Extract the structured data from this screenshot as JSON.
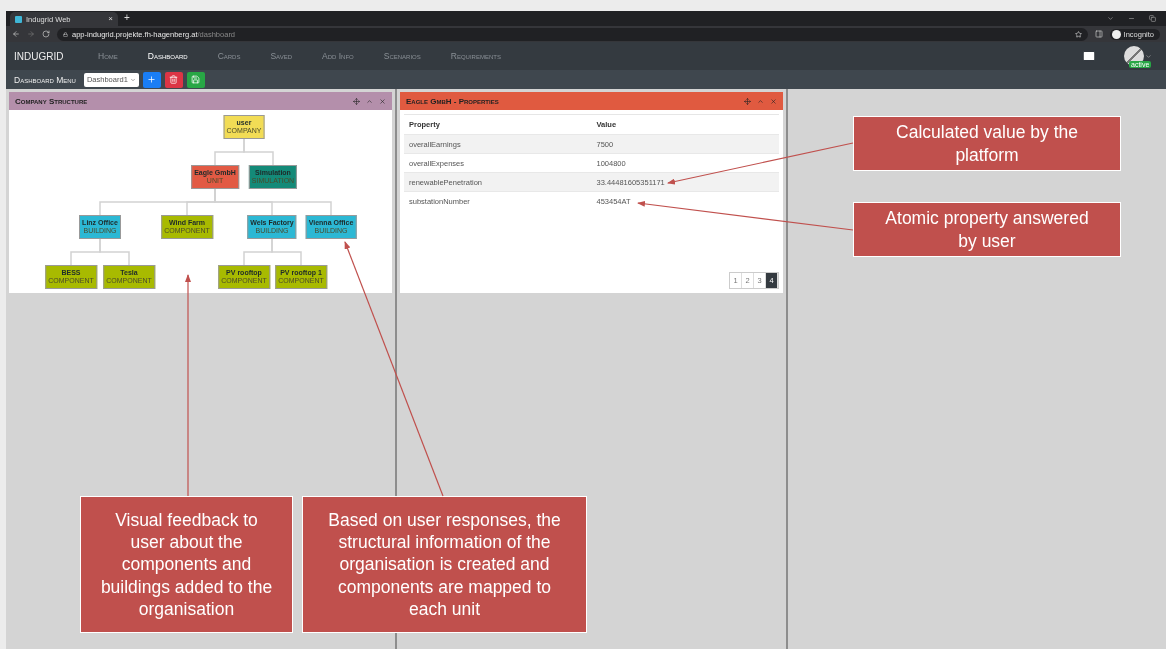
{
  "browser": {
    "tab": {
      "title": "Indugrid Web",
      "close": "×"
    },
    "new_tab": "+",
    "address": {
      "host": "app-indugrid.projekte.fh-hagenberg.at",
      "path": "/dashboard"
    },
    "profile": "Incognito"
  },
  "navbar": {
    "brand": "INDUGRID",
    "items": [
      {
        "label": "Home",
        "selected": false
      },
      {
        "label": "Dashboard",
        "selected": true
      },
      {
        "label": "Cards",
        "selected": false
      },
      {
        "label": "Saved",
        "selected": false
      },
      {
        "label": "Add Info",
        "selected": false
      },
      {
        "label": "Scenarios",
        "selected": false
      },
      {
        "label": "Requirements",
        "selected": false
      }
    ],
    "user_status": "active"
  },
  "dashboard_menu": {
    "title": "Dashboard Menu",
    "select": "Dashboard1",
    "buttons": [
      {
        "kind": "add"
      },
      {
        "kind": "delete"
      },
      {
        "kind": "save"
      }
    ]
  },
  "company_structure": {
    "title": "Company Structure",
    "tree": {
      "name": "user",
      "type": "COMPANY",
      "color": "#f2dc55",
      "children": [
        {
          "name": "Eagle GmbH",
          "type": "UNIT",
          "color": "#e25a44",
          "children": [
            {
              "name": "Linz Office",
              "type": "BUILDING",
              "color": "#2cb8d4",
              "children": [
                {
                  "name": "BESS",
                  "type": "COMPONENT",
                  "color": "#a8ba00"
                },
                {
                  "name": "Tesla",
                  "type": "COMPONENT",
                  "color": "#a8ba00"
                }
              ]
            },
            {
              "name": "Wind Farm",
              "type": "COMPONENT",
              "color": "#a8ba00"
            },
            {
              "name": "Wels Factory",
              "type": "BUILDING",
              "color": "#2cb8d4",
              "children": [
                {
                  "name": "PV rooftop",
                  "type": "COMPONENT",
                  "color": "#a8ba00"
                },
                {
                  "name": "PV rooftop 1",
                  "type": "COMPONENT",
                  "color": "#a8ba00"
                }
              ]
            },
            {
              "name": "Vienna Office",
              "type": "BUILDING",
              "color": "#2cb8d4"
            }
          ]
        },
        {
          "name": "Simulation",
          "type": "SIMULATION",
          "color": "#148a78"
        }
      ]
    }
  },
  "properties": {
    "title": "Eagle GmbH - Properties",
    "columns": [
      "Property",
      "Value"
    ],
    "rows": [
      [
        "overallEarnings",
        "7500"
      ],
      [
        "overallExpenses",
        "1004800"
      ],
      [
        "renewablePenetration",
        "33.44481605351171"
      ],
      [
        "substationNumber",
        "453454AT"
      ]
    ],
    "pages": [
      {
        "label": "1",
        "selected": false
      },
      {
        "label": "2",
        "selected": false
      },
      {
        "label": "3",
        "selected": false
      },
      {
        "label": "4",
        "selected": true
      }
    ]
  },
  "annotations": [
    {
      "text": "Calculated value by the platform"
    },
    {
      "text": "Atomic property answered by user"
    },
    {
      "text": "Visual feedback to user about the components and buildings added to the organisation"
    },
    {
      "text": "Based on user responses, the structural information of the organisation is created and components are mapped to each unit"
    }
  ]
}
